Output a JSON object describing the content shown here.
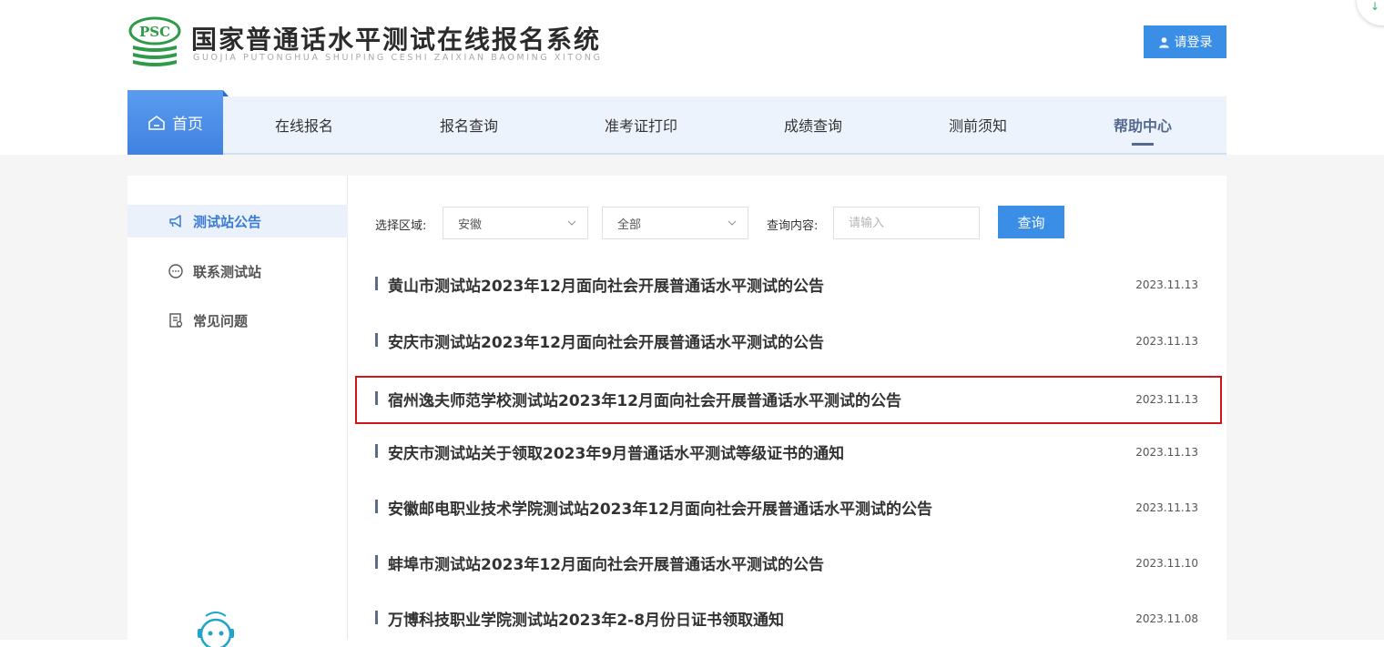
{
  "colors": {
    "accent": "#3a8ee6",
    "nav_bg": "#edf3fc",
    "highlight_border": "#d0151b",
    "logo_green": "#2e9b4a"
  },
  "logo": {
    "text": "PSC"
  },
  "header": {
    "title": "国家普通话水平测试在线报名系统",
    "subtitle": "GUOJIA PUTONGHUA SHUIPING CESHI ZAIXIAN BAOMING XITONG",
    "login_label": "请登录"
  },
  "nav": {
    "home": "首页",
    "items": [
      "在线报名",
      "报名查询",
      "准考证打印",
      "成绩查询",
      "测前须知",
      "帮助中心"
    ],
    "active": "帮助中心"
  },
  "sidebar": {
    "items": [
      {
        "label": "测试站公告",
        "icon": "megaphone-icon",
        "active": true
      },
      {
        "label": "联系测试站",
        "icon": "chat-icon",
        "active": false
      },
      {
        "label": "常见问题",
        "icon": "document-icon",
        "active": false
      }
    ]
  },
  "filter": {
    "region_label": "选择区域:",
    "region_value": "安徽",
    "scope_value": "全部",
    "query_label": "查询内容:",
    "query_placeholder": "请输入",
    "query_button": "查询"
  },
  "notices": [
    {
      "title": "黄山市测试站2023年12月面向社会开展普通话水平测试的公告",
      "date": "2023.11.13"
    },
    {
      "title": "安庆市测试站2023年12月面向社会开展普通话水平测试的公告",
      "date": "2023.11.13"
    },
    {
      "title": "宿州逸夫师范学校测试站2023年12月面向社会开展普通话水平测试的公告",
      "date": "2023.11.13",
      "highlighted": true
    },
    {
      "title": "安庆市测试站关于领取2023年9月普通话水平测试等级证书的通知",
      "date": "2023.11.13"
    },
    {
      "title": "安徽邮电职业技术学院测试站2023年12月面向社会开展普通话水平测试的公告",
      "date": "2023.11.13"
    },
    {
      "title": "蚌埠市测试站2023年12月面向社会开展普通话水平测试的公告",
      "date": "2023.11.10"
    },
    {
      "title": "万博科技职业学院测试站2023年2-8月份日证书领取通知",
      "date": "2023.11.08"
    }
  ]
}
